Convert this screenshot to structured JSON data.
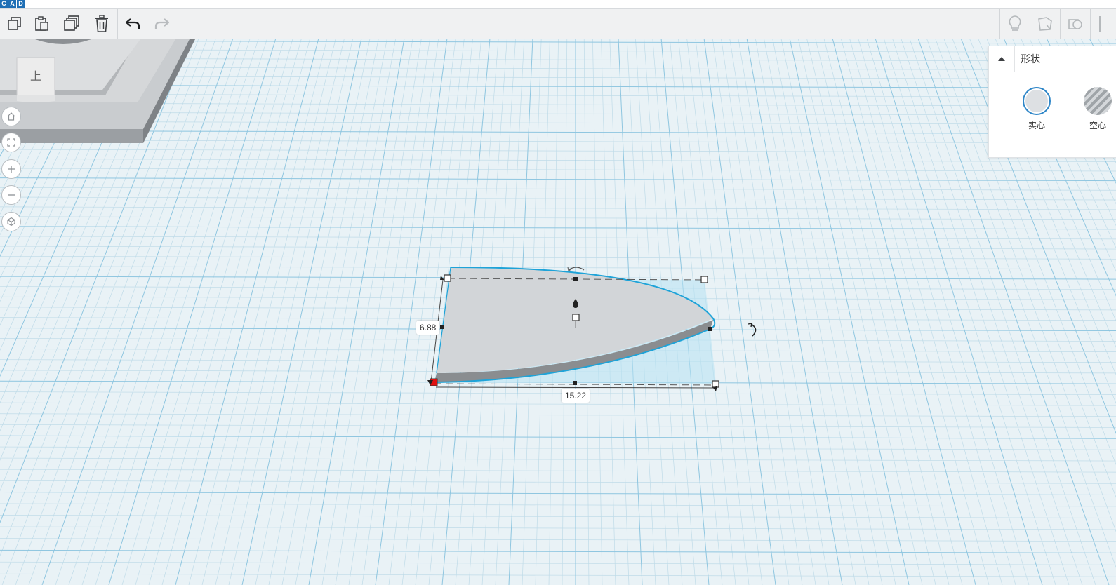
{
  "app": {
    "logo_letters": [
      "C",
      "A",
      "D"
    ]
  },
  "toolbar": {
    "left_tools": [
      "copy-icon",
      "paste-icon",
      "duplicate-icon",
      "delete-icon",
      "undo-icon",
      "redo-icon"
    ],
    "right_tools": [
      "lightbulb-icon",
      "notes-icon",
      "shapes-icon"
    ]
  },
  "view_controls": [
    "home-icon",
    "fit-view-icon",
    "zoom-in-icon",
    "zoom-out-icon",
    "perspective-icon"
  ],
  "view_cube": {
    "face_label": "上"
  },
  "selection": {
    "width_label": "15.22",
    "depth_label": "6.88"
  },
  "shape_panel": {
    "title": "形状",
    "options": [
      {
        "label": "实心",
        "selected": true,
        "color": "#dde0e3"
      },
      {
        "label": "空心",
        "selected": false,
        "color": "#9fa4a8"
      }
    ]
  },
  "colors": {
    "grid_line": "#8fc6e0",
    "selection_outline": "#1ea3d8",
    "shape_fill": "#d2d5d8",
    "shape_side": "#8a8d90",
    "handle_active": "#e01010"
  }
}
